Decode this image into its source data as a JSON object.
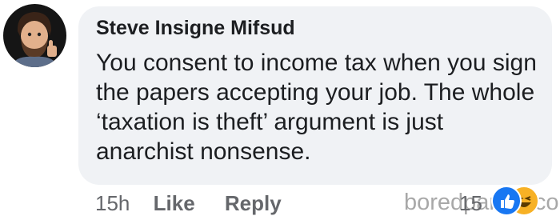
{
  "comment": {
    "author": "Steve Insigne Mifsud",
    "text": "You consent to income tax when you sign the papers accepting your job. The whole ‘taxation is theft’ argument is just anarchist nonsense.",
    "timestamp": "15h",
    "like_label": "Like",
    "reply_label": "Reply",
    "reaction_count": "15",
    "reactions": [
      "like-icon",
      "haha-icon"
    ]
  },
  "watermark": "boredpanda.com",
  "colors": {
    "bubble": "#f0f2f5",
    "text": "#1c1e21",
    "secondary_text": "#65676b",
    "like_blue": "#1877f2",
    "haha_yellow": "#f7b125"
  }
}
